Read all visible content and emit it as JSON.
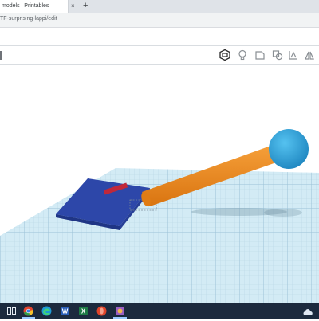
{
  "browser": {
    "tab_title": "models | Printables",
    "tab_close": "×",
    "new_tab": "+",
    "url": "TF-surprising-lappi/edit"
  },
  "toolbar": {
    "icons": [
      "notes-icon",
      "light-bulb-icon",
      "workplane-icon",
      "group-icon",
      "align-icon",
      "mirror-icon"
    ]
  },
  "scene": {
    "objects": [
      "blue-base-block",
      "orange-rod",
      "blue-sphere"
    ],
    "colors": {
      "grid": "#c6e3f0",
      "base": "#2f4bb0",
      "rod": "#f28a20",
      "sphere": "#2ea3d8"
    }
  },
  "taskbar": {
    "apps": [
      "task-view-icon",
      "chrome-icon",
      "edge-icon",
      "word-icon",
      "excel-icon",
      "opera-icon",
      "paint-icon"
    ]
  }
}
